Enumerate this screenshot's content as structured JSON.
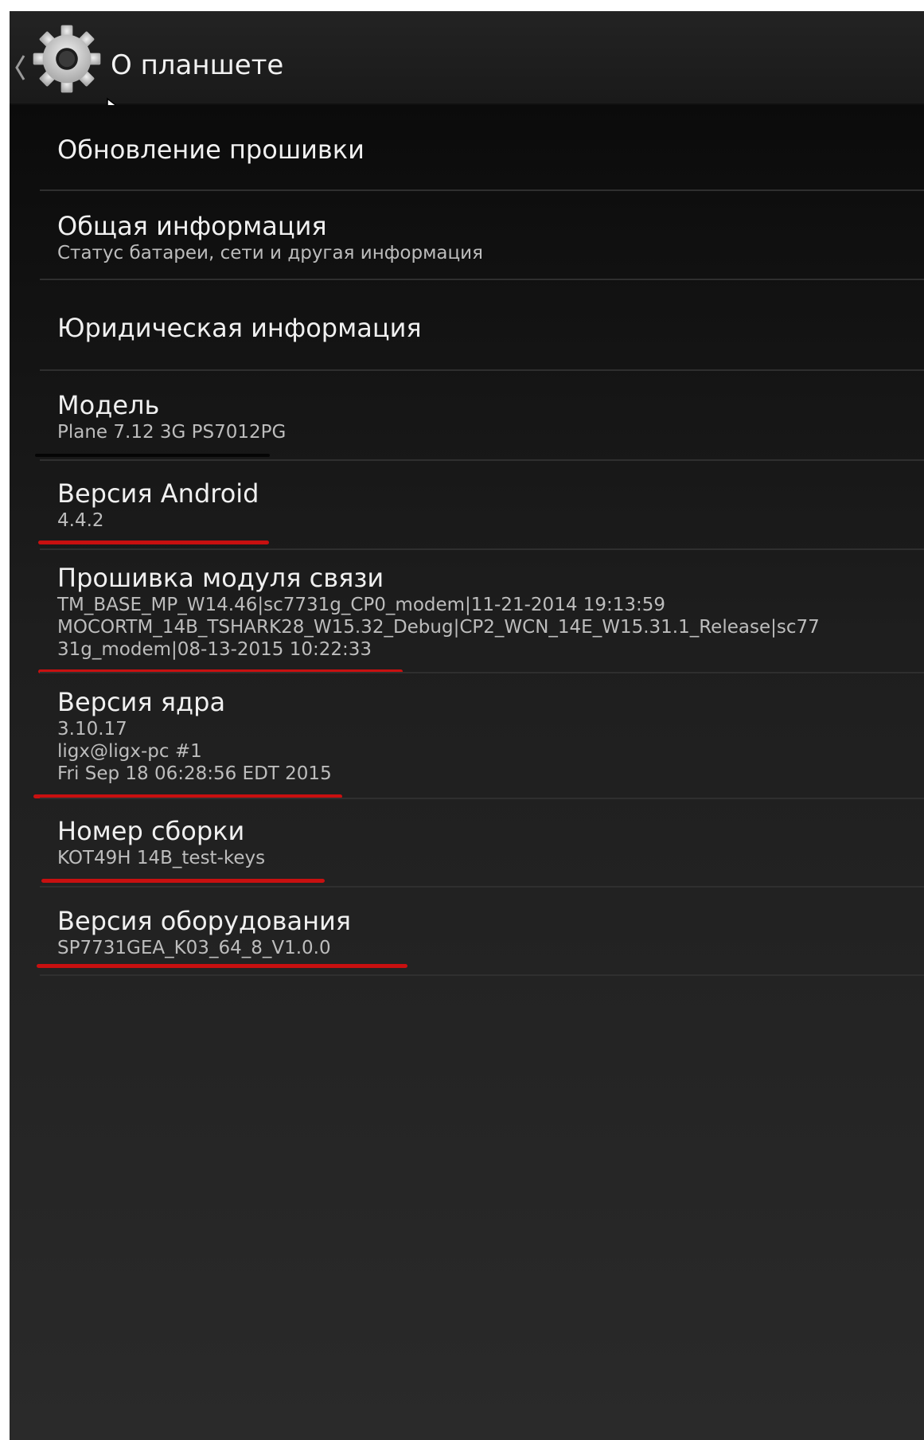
{
  "action_bar": {
    "title": "О планшете",
    "back_icon": "chevron-left-icon",
    "app_icon": "gear-icon"
  },
  "items": [
    {
      "label": "Обновление прошивки"
    },
    {
      "label": "Общая информация",
      "sub": "Статус батареи, сети и другая информация"
    },
    {
      "label": "Юридическая информация"
    },
    {
      "label": "Модель",
      "sub": "Plane 7.12 3G PS7012PG"
    },
    {
      "label": "Версия Android",
      "sub": "4.4.2"
    },
    {
      "label": "Прошивка модуля связи",
      "sub_lines": [
        "TM_BASE_MP_W14.46|sc7731g_CP0_modem|11-21-2014 19:13:59",
        "MOCORTM_14B_TSHARK28_W15.32_Debug|CP2_WCN_14E_W15.31.1_Release|sc77",
        "31g_modem|08-13-2015 10:22:33"
      ]
    },
    {
      "label": "Версия ядра",
      "sub_lines": [
        "3.10.17",
        "ligx@ligx-pc #1",
        "Fri Sep 18 06:28:56 EDT 2015"
      ]
    },
    {
      "label": "Номер сборки",
      "sub": "KOT49H 14B_test-keys"
    },
    {
      "label": "Версия оборудования",
      "sub": "SP7731GEA_K03_64_8_V1.0.0"
    }
  ],
  "colors": {
    "background": "#000000",
    "action_bar": "#232323",
    "primary_text": "#f0f0f0",
    "secondary_text": "#bdbdbd",
    "highlight_underline": "#c81010"
  }
}
